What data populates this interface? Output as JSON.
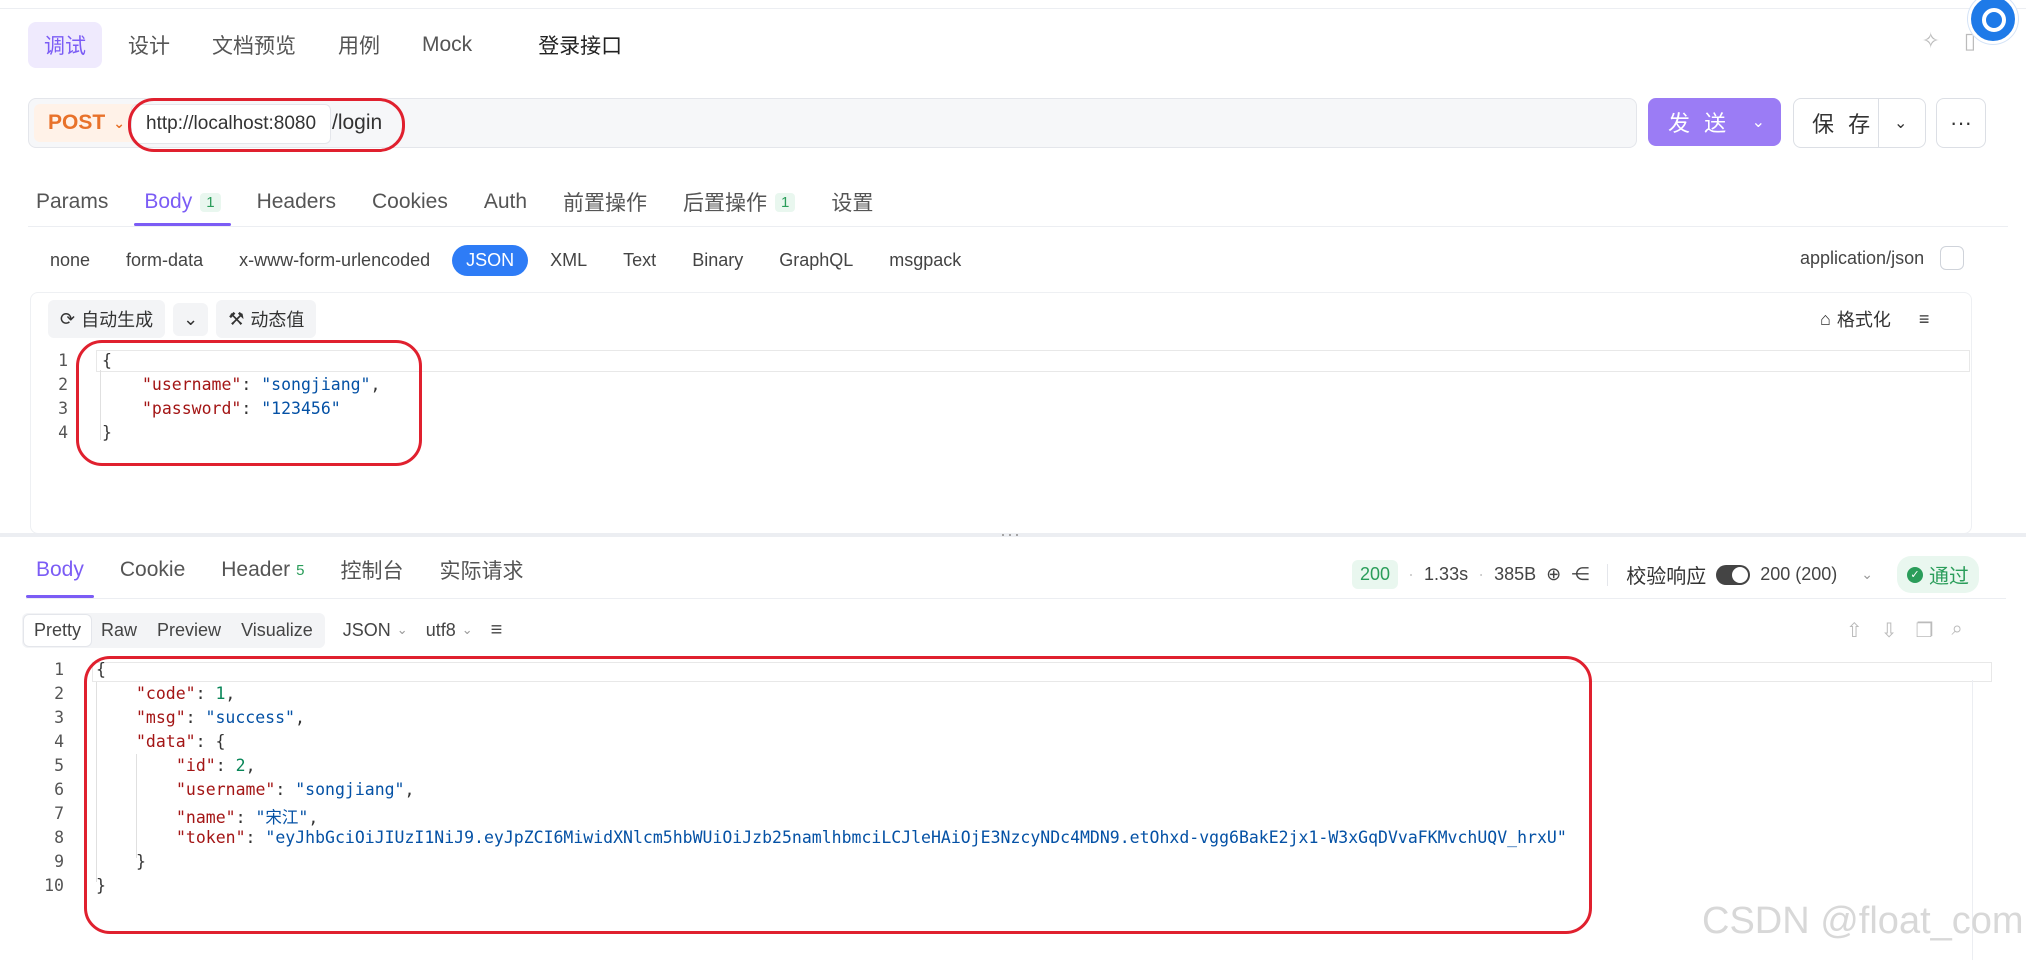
{
  "top_tabs": [
    "调试",
    "设计",
    "文档预览",
    "用例",
    "Mock"
  ],
  "request_title": "登录接口",
  "request": {
    "method": "POST",
    "base_url": "http://localhost:8080",
    "path": "/login",
    "send_label": "发 送",
    "save_label": "保 存",
    "more_label": "···"
  },
  "req_tabs": [
    {
      "label": "Params",
      "count": ""
    },
    {
      "label": "Body",
      "count": "1"
    },
    {
      "label": "Headers",
      "count": ""
    },
    {
      "label": "Cookies",
      "count": ""
    },
    {
      "label": "Auth",
      "count": ""
    },
    {
      "label": "前置操作",
      "count": ""
    },
    {
      "label": "后置操作",
      "count": "1"
    },
    {
      "label": "设置",
      "count": ""
    }
  ],
  "body_types": [
    "none",
    "form-data",
    "x-www-form-urlencoded",
    "JSON",
    "XML",
    "Text",
    "Binary",
    "GraphQL",
    "msgpack"
  ],
  "content_type": "application/json",
  "editor": {
    "auto_gen": "自动生成",
    "dynamic": "动态值",
    "format": "格式化"
  },
  "request_body_lines": [
    {
      "n": "1",
      "segs": [
        {
          "t": "{",
          "c": "p"
        }
      ],
      "indent": 0
    },
    {
      "n": "2",
      "segs": [
        {
          "t": "\"username\"",
          "c": "k"
        },
        {
          "t": ": ",
          "c": "p"
        },
        {
          "t": "\"songjiang\"",
          "c": "s"
        },
        {
          "t": ",",
          "c": "p"
        }
      ],
      "indent": 1
    },
    {
      "n": "3",
      "segs": [
        {
          "t": "\"password\"",
          "c": "k"
        },
        {
          "t": ": ",
          "c": "p"
        },
        {
          "t": "\"123456\"",
          "c": "s"
        }
      ],
      "indent": 1
    },
    {
      "n": "4",
      "segs": [
        {
          "t": "}",
          "c": "p"
        }
      ],
      "indent": 0
    }
  ],
  "resp_tabs": [
    {
      "label": "Body",
      "count": ""
    },
    {
      "label": "Cookie",
      "count": ""
    },
    {
      "label": "Header",
      "count": "5"
    },
    {
      "label": "控制台",
      "count": ""
    },
    {
      "label": "实际请求",
      "count": ""
    }
  ],
  "response_status": {
    "code": "200",
    "time": "1.33s",
    "size": "385B",
    "validate_label": "校验响应",
    "validate_value": "200 (200)",
    "pass_label": "通过"
  },
  "view_modes": [
    "Pretty",
    "Raw",
    "Preview",
    "Visualize"
  ],
  "format_select": "JSON",
  "encoding_select": "utf8",
  "response_body_lines": [
    {
      "n": "1",
      "segs": [
        {
          "t": "{",
          "c": "p"
        }
      ],
      "indent": 0
    },
    {
      "n": "2",
      "segs": [
        {
          "t": "\"code\"",
          "c": "k"
        },
        {
          "t": ": ",
          "c": "p"
        },
        {
          "t": "1",
          "c": "n"
        },
        {
          "t": ",",
          "c": "p"
        }
      ],
      "indent": 1
    },
    {
      "n": "3",
      "segs": [
        {
          "t": "\"msg\"",
          "c": "k"
        },
        {
          "t": ": ",
          "c": "p"
        },
        {
          "t": "\"success\"",
          "c": "s"
        },
        {
          "t": ",",
          "c": "p"
        }
      ],
      "indent": 1
    },
    {
      "n": "4",
      "segs": [
        {
          "t": "\"data\"",
          "c": "k"
        },
        {
          "t": ": {",
          "c": "p"
        }
      ],
      "indent": 1
    },
    {
      "n": "5",
      "segs": [
        {
          "t": "\"id\"",
          "c": "k"
        },
        {
          "t": ": ",
          "c": "p"
        },
        {
          "t": "2",
          "c": "n"
        },
        {
          "t": ",",
          "c": "p"
        }
      ],
      "indent": 2
    },
    {
      "n": "6",
      "segs": [
        {
          "t": "\"username\"",
          "c": "k"
        },
        {
          "t": ": ",
          "c": "p"
        },
        {
          "t": "\"songjiang\"",
          "c": "s"
        },
        {
          "t": ",",
          "c": "p"
        }
      ],
      "indent": 2
    },
    {
      "n": "7",
      "segs": [
        {
          "t": "\"name\"",
          "c": "k"
        },
        {
          "t": ": ",
          "c": "p"
        },
        {
          "t": "\"宋江\"",
          "c": "s"
        },
        {
          "t": ",",
          "c": "p"
        }
      ],
      "indent": 2
    },
    {
      "n": "8",
      "segs": [
        {
          "t": "\"token\"",
          "c": "k"
        },
        {
          "t": ": ",
          "c": "p"
        },
        {
          "t": "\"eyJhbGciOiJIUzI1NiJ9.eyJpZCI6MiwidXNlcm5hbWUiOiJzb25namlhbmciLCJleHAiOjE3NzcyNDc4MDN9.etOhxd-vgg6BakE2jx1-W3xGqDVvaFKMvchUQV_hrxU\"",
          "c": "s"
        }
      ],
      "indent": 2
    },
    {
      "n": "9",
      "segs": [
        {
          "t": "}",
          "c": "p"
        }
      ],
      "indent": 1
    },
    {
      "n": "10",
      "segs": [
        {
          "t": "}",
          "c": "p"
        }
      ],
      "indent": 0
    }
  ],
  "watermark": "CSDN @float_com",
  "colors": {
    "accent": "#7b5cf5",
    "method": "#e8722a",
    "annotation": "#e0202e",
    "success": "#2a9d5a",
    "json_active": "#2e7cf6"
  }
}
